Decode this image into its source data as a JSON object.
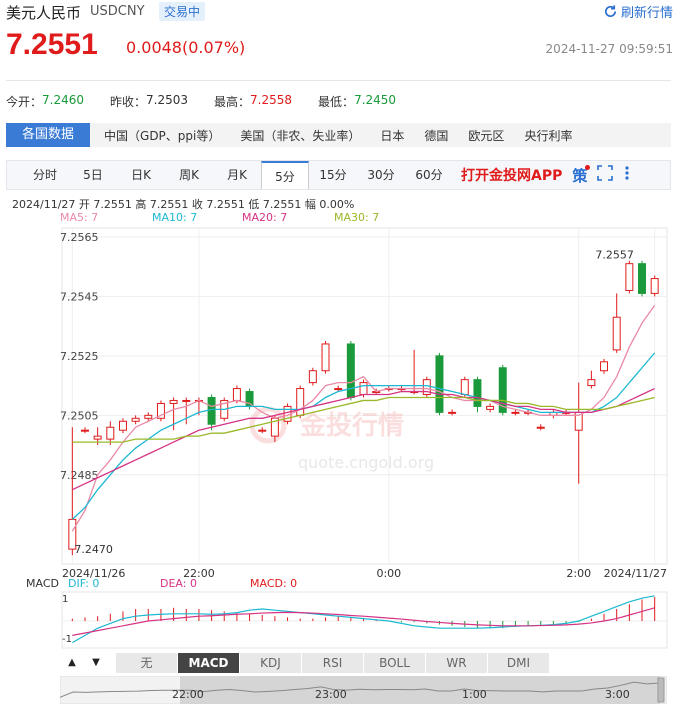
{
  "header": {
    "title": "美元人民币",
    "symbol": "USDCNY",
    "status": "交易中",
    "refresh_label": "刷新行情",
    "price": "7.2551",
    "change": "0.0048(0.07%)",
    "datetime": "2024-11-27 09:59:51"
  },
  "stats": [
    {
      "label": "今开：",
      "value": "7.2460"
    },
    {
      "label": "昨收：",
      "value": "7.2503"
    },
    {
      "label": "最高：",
      "value": "7.2558"
    },
    {
      "label": "最低：",
      "value": "7.2450"
    }
  ],
  "data_bar": {
    "active": "各国数据",
    "items": [
      "中国（GDP、ppi等）",
      "美国（非农、失业率）",
      "日本",
      "德国",
      "欧元区",
      "央行利率"
    ]
  },
  "tabs": {
    "items": [
      "分时",
      "5日",
      "日K",
      "周K",
      "月K",
      "5分",
      "15分",
      "30分",
      "60分"
    ],
    "selected": "5分",
    "app_label": "打开金投网APP",
    "strategy_label": "策"
  },
  "ohlc_line": "2024/11/27  开 7.2551  高 7.2551  收 7.2551  低 7.2551  幅 0.00%",
  "ma_legend": [
    {
      "label": "MA5: 7",
      "color": "#e98aa6"
    },
    {
      "label": "MA10: 7",
      "color": "#1cb8d2"
    },
    {
      "label": "MA20: 7",
      "color": "#d63384"
    },
    {
      "label": "MA30: 7",
      "color": "#9ab827"
    }
  ],
  "macd_legend": {
    "name": "MACD",
    "dif": "DIF: 0",
    "dea": "DEA: 0",
    "macd": "MACD: 0"
  },
  "indicators": {
    "items": [
      "无",
      "MACD",
      "KDJ",
      "RSI",
      "BOLL",
      "WR",
      "DMI"
    ],
    "selected": "MACD",
    "up_arrow": "▲",
    "down_arrow": "▼"
  },
  "watermark": {
    "cn": "金投行情",
    "url": "quote.cngold.org"
  },
  "chart_data": {
    "type": "candlestick",
    "y_ticks": [
      "7.2565",
      "7.2545",
      "7.2525",
      "7.2505",
      "7.2485"
    ],
    "ylim": [
      7.2455,
      7.2568
    ],
    "x_ticks": [
      "2024/11/26",
      "22:00",
      "0:00",
      "2:00",
      "2024/11/27"
    ],
    "max_label": "7.2557",
    "min_label": "7.2470",
    "macd_y_ticks": [
      "1",
      "-1"
    ],
    "navigator_ticks": [
      "22:00",
      "23:00",
      "1:00",
      "3:00"
    ],
    "colors": {
      "up": "#e01b1b",
      "down": "#1a9a3a"
    },
    "candles": [
      [
        7.246,
        7.247,
        7.2501,
        7.2458
      ],
      [
        7.25,
        7.25,
        7.2501,
        7.2499
      ],
      [
        7.2497,
        7.2498,
        7.2501,
        7.2495
      ],
      [
        7.2497,
        7.2501,
        7.2503,
        7.2495
      ],
      [
        7.25,
        7.2503,
        7.2504,
        7.2499
      ],
      [
        7.2503,
        7.2504,
        7.2505,
        7.2502
      ],
      [
        7.2504,
        7.2505,
        7.2506,
        7.2503
      ],
      [
        7.2504,
        7.2509,
        7.251,
        7.2503
      ],
      [
        7.2509,
        7.251,
        7.2511,
        7.25
      ],
      [
        7.251,
        7.251,
        7.2511,
        7.2502
      ],
      [
        7.251,
        7.251,
        7.2511,
        7.2505
      ],
      [
        7.2511,
        7.2502,
        7.2512,
        7.25
      ],
      [
        7.2504,
        7.251,
        7.2511,
        7.2503
      ],
      [
        7.251,
        7.2514,
        7.2515,
        7.2509
      ],
      [
        7.2513,
        7.2508,
        7.2514,
        7.2507
      ],
      [
        7.25,
        7.25,
        7.2501,
        7.2499
      ],
      [
        7.2498,
        7.2504,
        7.2505,
        7.2496
      ],
      [
        7.2503,
        7.2508,
        7.2509,
        7.2502
      ],
      [
        7.2505,
        7.2514,
        7.2515,
        7.2504
      ],
      [
        7.2516,
        7.252,
        7.2521,
        7.2515
      ],
      [
        7.252,
        7.2529,
        7.253,
        7.2519
      ],
      [
        7.2514,
        7.2514,
        7.2515,
        7.2513
      ],
      [
        7.2529,
        7.2511,
        7.253,
        7.251
      ],
      [
        7.2512,
        7.2516,
        7.2517,
        7.2511
      ],
      [
        7.2513,
        7.2513,
        7.2514,
        7.2512
      ],
      [
        7.2514,
        7.2514,
        7.2515,
        7.2513
      ],
      [
        7.2514,
        7.2514,
        7.2515,
        7.2513
      ],
      [
        7.2513,
        7.2513,
        7.2527,
        7.2512
      ],
      [
        7.2512,
        7.2517,
        7.2518,
        7.2511
      ],
      [
        7.2525,
        7.2506,
        7.2526,
        7.2505
      ],
      [
        7.2506,
        7.2506,
        7.2507,
        7.2505
      ],
      [
        7.2512,
        7.2517,
        7.2518,
        7.2511
      ],
      [
        7.2517,
        7.2508,
        7.2518,
        7.2506
      ],
      [
        7.2507,
        7.2508,
        7.2509,
        7.2506
      ],
      [
        7.2521,
        7.2506,
        7.2522,
        7.2505
      ],
      [
        7.2506,
        7.2506,
        7.2507,
        7.2505
      ],
      [
        7.2506,
        7.2506,
        7.2507,
        7.2505
      ],
      [
        7.2501,
        7.2501,
        7.2502,
        7.25
      ],
      [
        7.2505,
        7.2506,
        7.2507,
        7.2504
      ],
      [
        7.2506,
        7.2506,
        7.2507,
        7.2505
      ],
      [
        7.25,
        7.2506,
        7.2516,
        7.2482
      ],
      [
        7.2515,
        7.2517,
        7.252,
        7.2514
      ],
      [
        7.252,
        7.2523,
        7.2524,
        7.2519
      ],
      [
        7.2527,
        7.2538,
        7.2546,
        7.2526
      ],
      [
        7.2547,
        7.2556,
        7.2557,
        7.2546
      ],
      [
        7.2556,
        7.2546,
        7.2557,
        7.2545
      ],
      [
        7.2546,
        7.2551,
        7.2552,
        7.2545
      ]
    ],
    "ma_series": [
      {
        "label": "MA5",
        "color": "#e98aa6",
        "values": [
          7.2466,
          7.2473,
          7.2485,
          7.249,
          7.2496,
          7.2501,
          7.2503,
          7.2505,
          7.2507,
          7.2508,
          7.251,
          7.2508,
          7.2509,
          7.251,
          7.2509,
          7.2506,
          7.2504,
          7.2505,
          7.2507,
          7.251,
          7.2515,
          7.2516,
          7.2516,
          7.2518,
          7.2513,
          7.2514,
          7.2514,
          7.2514,
          7.2514,
          7.2513,
          7.2511,
          7.251,
          7.251,
          7.251,
          7.2508,
          7.2507,
          7.2506,
          7.2505,
          7.2505,
          7.2505,
          7.2505,
          7.2507,
          7.2511,
          7.2518,
          7.2528,
          7.2536,
          7.2542
        ]
      },
      {
        "label": "MA10",
        "color": "#1cb8d2",
        "values": [
          7.247,
          7.2474,
          7.248,
          7.2485,
          7.249,
          7.2494,
          7.2497,
          7.25,
          7.2502,
          7.2504,
          7.2506,
          7.2507,
          7.2507,
          7.2508,
          7.2508,
          7.2508,
          7.2507,
          7.2507,
          7.2507,
          7.2508,
          7.2511,
          7.2513,
          7.2514,
          7.2515,
          7.2515,
          7.2515,
          7.2515,
          7.2515,
          7.2515,
          7.2514,
          7.2513,
          7.2512,
          7.2511,
          7.251,
          7.2509,
          7.2508,
          7.2507,
          7.2506,
          7.2506,
          7.2506,
          7.2506,
          7.2506,
          7.2508,
          7.2511,
          7.2516,
          7.2521,
          7.2526
        ]
      },
      {
        "label": "MA20",
        "color": "#d63384",
        "values": [
          7.248,
          7.2482,
          7.2484,
          7.2486,
          7.2488,
          7.249,
          7.2492,
          7.2494,
          7.2496,
          7.2498,
          7.25,
          7.2501,
          7.2502,
          7.2503,
          7.2504,
          7.2504,
          7.2505,
          7.2506,
          7.2507,
          7.2508,
          7.2509,
          7.251,
          7.2511,
          7.2512,
          7.2512,
          7.2512,
          7.2513,
          7.2513,
          7.2513,
          7.2512,
          7.2512,
          7.2511,
          7.2511,
          7.251,
          7.2509,
          7.2508,
          7.2508,
          7.2507,
          7.2507,
          7.2506,
          7.2506,
          7.2506,
          7.2507,
          7.2508,
          7.251,
          7.2512,
          7.2514
        ]
      },
      {
        "label": "MA30",
        "color": "#9ab827",
        "values": [
          7.2496,
          7.2496,
          7.2496,
          7.2496,
          7.2496,
          7.2497,
          7.2497,
          7.2497,
          7.2497,
          7.2498,
          7.2498,
          7.2499,
          7.2499,
          7.25,
          7.2501,
          7.2502,
          7.2503,
          7.2504,
          7.2505,
          7.2506,
          7.2507,
          7.2508,
          7.2509,
          7.251,
          7.251,
          7.2511,
          7.2511,
          7.2511,
          7.2511,
          7.2511,
          7.2511,
          7.2511,
          7.251,
          7.251,
          7.251,
          7.2509,
          7.2509,
          7.2508,
          7.2508,
          7.2507,
          7.2507,
          7.2507,
          7.2507,
          7.2508,
          7.2509,
          7.251,
          7.2511
        ]
      }
    ],
    "macd_hist": [
      0.1,
      0.15,
      0.2,
      0.3,
      0.4,
      0.5,
      0.5,
      0.5,
      0.55,
      0.5,
      0.5,
      0.45,
      0.4,
      0.35,
      0.3,
      0.25,
      0.2,
      0.15,
      0.1,
      0.1,
      0.15,
      0.2,
      0.15,
      0.1,
      0.05,
      0.0,
      -0.05,
      -0.05,
      -0.1,
      -0.15,
      -0.2,
      -0.25,
      -0.3,
      -0.3,
      -0.3,
      -0.25,
      -0.2,
      -0.2,
      -0.15,
      -0.1,
      -0.05,
      0.1,
      0.3,
      0.5,
      0.7,
      0.9,
      1.0
    ],
    "macd_dif": [
      -0.9,
      -0.6,
      -0.3,
      -0.1,
      0.1,
      0.2,
      0.25,
      0.28,
      0.3,
      0.3,
      0.3,
      0.28,
      0.3,
      0.35,
      0.45,
      0.5,
      0.45,
      0.4,
      0.35,
      0.3,
      0.25,
      0.2,
      0.15,
      0.1,
      0.05,
      0.0,
      -0.1,
      -0.2,
      -0.25,
      -0.3,
      -0.3,
      -0.3,
      -0.3,
      -0.28,
      -0.25,
      -0.22,
      -0.2,
      -0.18,
      -0.15,
      -0.1,
      0.0,
      0.2,
      0.4,
      0.6,
      0.8,
      0.95,
      1.05
    ],
    "macd_dea": [
      -0.6,
      -0.5,
      -0.4,
      -0.3,
      -0.2,
      -0.1,
      0.0,
      0.05,
      0.1,
      0.15,
      0.2,
      0.22,
      0.25,
      0.28,
      0.3,
      0.33,
      0.35,
      0.36,
      0.35,
      0.33,
      0.3,
      0.27,
      0.23,
      0.2,
      0.16,
      0.12,
      0.08,
      0.03,
      -0.02,
      -0.06,
      -0.1,
      -0.13,
      -0.16,
      -0.18,
      -0.2,
      -0.2,
      -0.2,
      -0.19,
      -0.18,
      -0.16,
      -0.13,
      -0.08,
      0.0,
      0.1,
      0.25,
      0.4,
      0.55
    ]
  }
}
